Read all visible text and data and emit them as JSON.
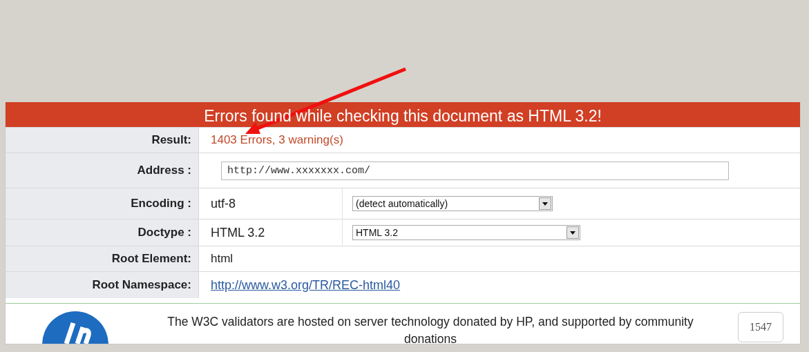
{
  "banner": {
    "title": "Errors found while checking this document as HTML 3.2!"
  },
  "rows": [
    {
      "kind": "result",
      "label": "Result:",
      "value": "1403 Errors, 3 warning(s)"
    },
    {
      "kind": "input",
      "label": "Address :",
      "value": "http://www.xxxxxxx.com/"
    },
    {
      "kind": "select",
      "label": "Encoding :",
      "value": "utf-8",
      "option": "(detect automatically)"
    },
    {
      "kind": "select",
      "label": "Doctype :",
      "value": "HTML 3.2",
      "option": "HTML 3.2"
    },
    {
      "kind": "text",
      "label": "Root Element:",
      "value": "html"
    },
    {
      "kind": "link",
      "label": "Root Namespace:",
      "value": "http://www.w3.org/TR/REC-html40"
    }
  ],
  "footer": {
    "text": "The W3C validators are hosted on server technology donated by HP, and supported by community donations",
    "badge": "1547"
  }
}
